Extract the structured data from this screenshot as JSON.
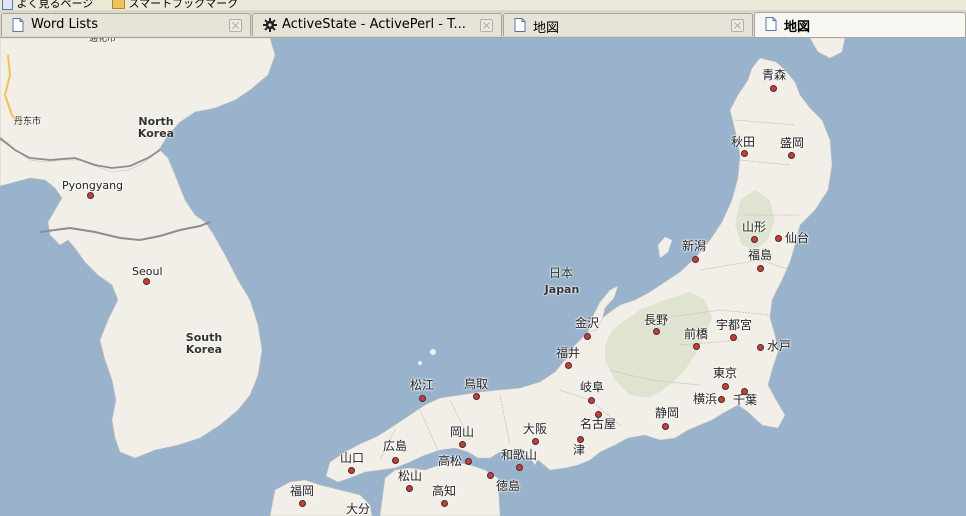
{
  "bookmarks_bar": {
    "items": [
      {
        "label": "よく見るページ"
      },
      {
        "label": "スマートブックマーク"
      }
    ]
  },
  "tabs": [
    {
      "label": "Word Lists",
      "icon": "page-icon",
      "active": false
    },
    {
      "label": "ActiveState - ActivePerl - T...",
      "icon": "gear-icon",
      "active": false
    },
    {
      "label": "地図",
      "icon": "page-icon",
      "active": false
    },
    {
      "label": "地図",
      "icon": "page-icon",
      "active": true
    }
  ],
  "map": {
    "water_color": "#99b3cc",
    "land_color": "#f2efe9",
    "country_labels": {
      "north_korea": "North Korea",
      "south_korea": "South Korea",
      "japan_ja": "日本",
      "japan_en": "Japan"
    },
    "cities": {
      "dandong": "丹东市",
      "pyongyang": "Pyongyang",
      "seoul": "Seoul",
      "aomori": "青森",
      "akita": "秋田",
      "morioka": "盛岡",
      "yamagata": "山形",
      "sendai": "仙台",
      "niigata": "新潟",
      "fukushima": "福島",
      "kanazawa": "金沢",
      "nagano": "長野",
      "maebashi": "前橋",
      "utsunomiya": "宇都宮",
      "fukui": "福井",
      "mito": "水戸",
      "matsue": "松江",
      "tottori": "鳥取",
      "gifu": "岐阜",
      "tokyo": "東京",
      "yokohama": "横浜",
      "chiba": "千葉",
      "nagoya": "名古屋",
      "shizuoka": "静岡",
      "okayama": "岡山",
      "osaka": "大阪",
      "hiroshima": "広島",
      "tsu": "津",
      "yamaguchi": "山口",
      "takamatsu": "高松",
      "wakayama": "和歌山",
      "matsuyama": "松山",
      "tokushima": "徳島",
      "kochi": "高知",
      "fukuoka": "福岡",
      "oita": "大分"
    }
  }
}
